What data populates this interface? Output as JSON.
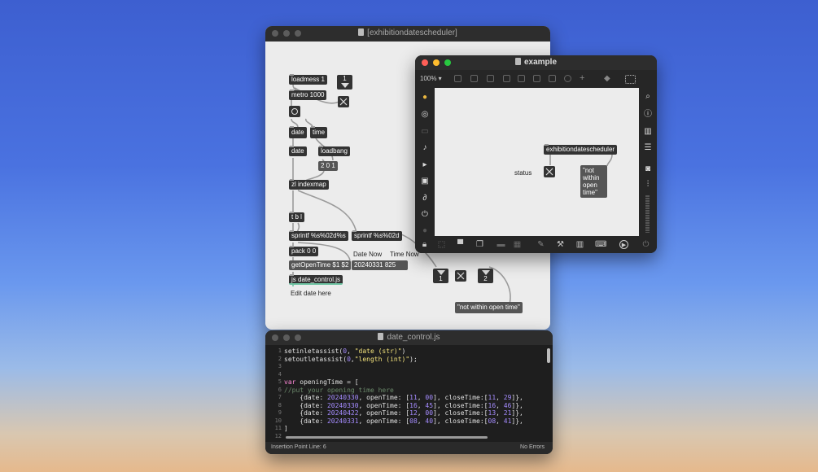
{
  "patcher": {
    "title": "[exhibitiondatescheduler]",
    "objects": {
      "loadmess": "loadmess 1",
      "metro": "metro 1000",
      "date1": "date",
      "time1": "time",
      "date2": "date",
      "loadbang": "loadbang",
      "msg201": "2 0 1",
      "zlindexmap": "zl indexmap",
      "tbl": "t b l",
      "sprintf1": "sprintf %s%02d%s",
      "sprintf2": "sprintf %s%02d",
      "pack": "pack 0 0",
      "getopen": "getOpenTime $1 $2",
      "msgdate": "20240331 825",
      "js": "js date_control.js",
      "outnotwithin": "\"not within open time\""
    },
    "numbers": {
      "top": "1",
      "out1": "1",
      "out2": "2"
    },
    "comments": {
      "date_now": "Date Now",
      "time_now": "Time Now",
      "edit_date": "Edit date here"
    }
  },
  "example": {
    "title": "example",
    "zoom": "100% ▾",
    "object": "exhibitiondatescheduler",
    "status_label": "status",
    "output_msg": "\"not within open time\""
  },
  "editor": {
    "title": "date_control.js",
    "status_left": "Insertion Point Line: 6",
    "status_right": "No Errors",
    "line_numbers": [
      "1",
      "2",
      "3",
      "4",
      "5",
      "6",
      "7",
      "8",
      "9",
      "10",
      "11",
      "12"
    ],
    "lines": [
      "setinletassist(0, \"date (str)\")",
      "setoutletassist(0,\"length (int)\");",
      "",
      "",
      "var openingTime = [",
      "//put your opening time here",
      "    {date: 20240330, openTime: [11, 00], closeTime:[11, 29]},",
      "    {date: 20240330, openTime: [16, 45], closeTime:[16, 46]},",
      "    {date: 20240422, openTime: [12, 00], closeTime:[13, 21]},",
      "    {date: 20240331, openTime: [08, 40], closeTime:[08, 41]},",
      "]",
      ""
    ]
  },
  "colors": {
    "close": "#ff5f57",
    "minimize": "#febc2e",
    "zoom": "#28c840",
    "keyword": "#ff8ad8",
    "string": "#f0e07a",
    "number": "#a58cff"
  }
}
